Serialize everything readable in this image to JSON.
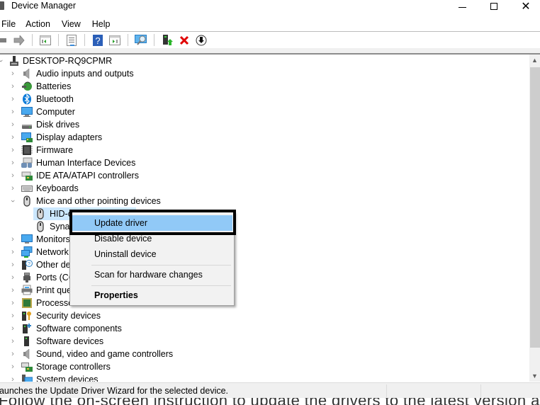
{
  "window": {
    "title": "Device Manager",
    "controls": {
      "minimize": "minimize",
      "maximize": "maximize",
      "close": "✕"
    }
  },
  "menubar": [
    "File",
    "Action",
    "View",
    "Help"
  ],
  "toolbar": {
    "buttons": [
      {
        "name": "back",
        "icon": "back-arrow-icon"
      },
      {
        "name": "forward",
        "icon": "forward-arrow-icon"
      },
      {
        "name": "show-hide-console-tree",
        "icon": "console-tree-icon"
      },
      {
        "name": "properties",
        "icon": "properties-icon"
      },
      {
        "name": "help",
        "icon": "help-icon"
      },
      {
        "name": "show-action-pane",
        "icon": "action-pane-icon"
      },
      {
        "name": "scan-hardware",
        "icon": "scan-monitor-icon"
      },
      {
        "name": "update-driver",
        "icon": "update-driver-icon"
      },
      {
        "name": "uninstall-device",
        "icon": "red-x-icon"
      },
      {
        "name": "disable-device",
        "icon": "down-arrow-circle-icon"
      }
    ]
  },
  "tree": {
    "root": "DESKTOP-RQ9CPMR",
    "items": [
      {
        "label": "Audio inputs and outputs",
        "icon": "speaker-icon",
        "expanded": false
      },
      {
        "label": "Batteries",
        "icon": "battery-icon",
        "expanded": false
      },
      {
        "label": "Bluetooth",
        "icon": "bluetooth-icon",
        "expanded": false
      },
      {
        "label": "Computer",
        "icon": "computer-icon",
        "expanded": false
      },
      {
        "label": "Disk drives",
        "icon": "disk-drive-icon",
        "expanded": false
      },
      {
        "label": "Display adapters",
        "icon": "display-adapter-icon",
        "expanded": false
      },
      {
        "label": "Firmware",
        "icon": "firmware-icon",
        "expanded": false
      },
      {
        "label": "Human Interface Devices",
        "icon": "hid-icon",
        "expanded": false
      },
      {
        "label": "IDE ATA/ATAPI controllers",
        "icon": "ide-controller-icon",
        "expanded": false
      },
      {
        "label": "Keyboards",
        "icon": "keyboard-icon",
        "expanded": false
      },
      {
        "label": "Mice and other pointing devices",
        "icon": "mouse-icon",
        "expanded": true,
        "children": [
          {
            "label": "HID-compliant mouse",
            "visible_label": "HID-c",
            "icon": "mouse-icon",
            "selected": true
          },
          {
            "label": "Synaptics",
            "visible_label": "Synap",
            "icon": "mouse-icon",
            "selected": false
          }
        ]
      },
      {
        "label": "Monitors",
        "icon": "monitor-icon",
        "expanded": false
      },
      {
        "label": "Network adapters",
        "visible_label": "Network",
        "icon": "network-icon",
        "expanded": false
      },
      {
        "label": "Other devices",
        "visible_label": "Other de",
        "icon": "unknown-device-icon",
        "expanded": false
      },
      {
        "label": "Ports (COM & LPT)",
        "visible_label": "Ports (CC",
        "icon": "port-icon",
        "expanded": false
      },
      {
        "label": "Print queues",
        "visible_label": "Print que",
        "icon": "printer-icon",
        "expanded": false
      },
      {
        "label": "Processors",
        "visible_label": "Processo",
        "icon": "processor-icon",
        "expanded": false
      },
      {
        "label": "Security devices",
        "icon": "security-key-icon",
        "expanded": false
      },
      {
        "label": "Software components",
        "icon": "software-component-icon",
        "expanded": false
      },
      {
        "label": "Software devices",
        "icon": "software-device-icon",
        "expanded": false
      },
      {
        "label": "Sound, video and game controllers",
        "icon": "speaker-icon",
        "expanded": false
      },
      {
        "label": "Storage controllers",
        "icon": "storage-controller-icon",
        "expanded": false
      },
      {
        "label": "System devices",
        "icon": "system-device-icon",
        "expanded": false
      }
    ]
  },
  "context_menu": {
    "items": [
      {
        "label": "Update driver",
        "highlighted": true,
        "bold": false
      },
      {
        "label": "Disable device",
        "highlighted": false,
        "bold": false
      },
      {
        "label": "Uninstall device",
        "highlighted": false,
        "bold": false
      },
      {
        "separator": true
      },
      {
        "label": "Scan for hardware changes",
        "highlighted": false,
        "bold": false
      },
      {
        "separator": true
      },
      {
        "label": "Properties",
        "highlighted": false,
        "bold": true
      }
    ]
  },
  "statusbar": {
    "text": "Launches the Update Driver Wizard for the selected device."
  },
  "caption": {
    "text": "Follow the on-screen instruction to update the drivers to the latest version automatically."
  },
  "colors": {
    "selection": "#cce8ff",
    "menu_highlight": "#91c9f7",
    "annotation_frame": "#000000"
  }
}
